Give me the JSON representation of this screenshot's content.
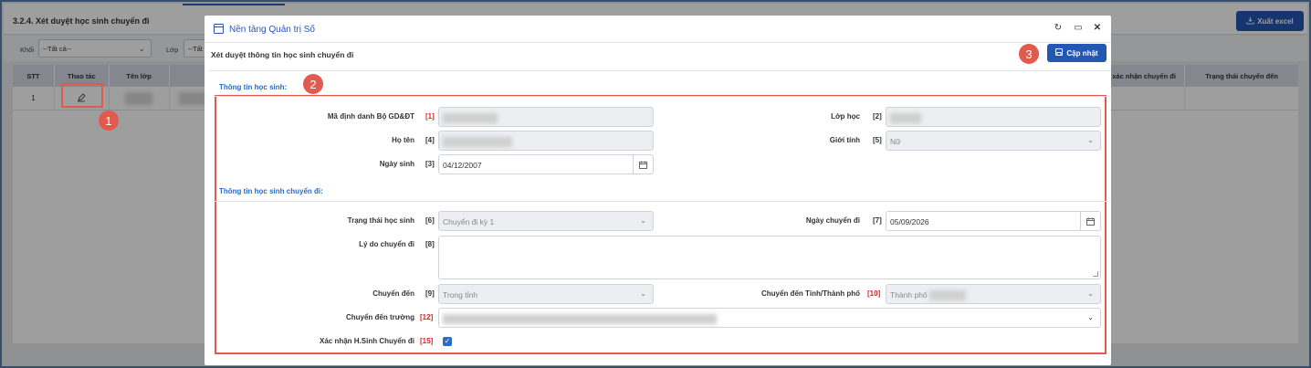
{
  "page": {
    "title": "3.2.4. Xét duyệt học sinh chuyển đi",
    "export_label": "Xuất excel",
    "filters": {
      "khoi_label": "Khối",
      "khoi_value": "--Tất cả--",
      "lop_label": "Lớp",
      "lop_value": "--Tất c"
    },
    "grid": {
      "columns": [
        "STT",
        "Thao tác",
        "Tên lớp",
        "",
        "",
        "...",
        "à xác nhận chuyển đi",
        "Trạng thái chuyển đến"
      ],
      "rows": [
        {
          "stt": "1"
        }
      ]
    }
  },
  "modal": {
    "title": "Nền tảng Quản trị Số",
    "subtitle": "Xét duyệt thông tin học sinh chuyển đi",
    "update_label": "Cập nhật",
    "section_student": "Thông tin học sinh:",
    "section_transfer": "Thông tin học sinh chuyển đi:",
    "fields": {
      "ma_dinh_danh": {
        "label": "Mã định danh Bộ GD&ĐT",
        "index": "[1]"
      },
      "lop_hoc": {
        "label": "Lớp học",
        "index": "[2]"
      },
      "ho_ten": {
        "label": "Họ tên",
        "index": "[4]"
      },
      "gioi_tinh": {
        "label": "Giới tính",
        "index": "[5]",
        "value": "Nữ"
      },
      "ngay_sinh": {
        "label": "Ngày sinh",
        "index": "[3]",
        "value": "04/12/2007"
      },
      "trang_thai": {
        "label": "Trạng thái học sinh",
        "index": "[6]",
        "value": "Chuyển đi kỳ 1"
      },
      "ngay_chuyen_di": {
        "label": "Ngày chuyển đi",
        "index": "[7]",
        "value": "05/09/2026"
      },
      "ly_do": {
        "label": "Lý do chuyển đi",
        "index": "[8]",
        "value": ""
      },
      "chuyen_den": {
        "label": "Chuyển đến",
        "index": "[9]",
        "value": "Trong tỉnh"
      },
      "chuyen_den_tinh": {
        "label": "Chuyển đến Tỉnh/Thành phố",
        "index": "[10]",
        "value": "Thành phố"
      },
      "chuyen_den_truong": {
        "label": "Chuyển đến trường",
        "index": "[12]"
      },
      "xac_nhan": {
        "label": "Xác nhận H.Sinh Chuyển đi",
        "index": "[15]",
        "checked": true
      }
    }
  },
  "annotations": {
    "one": "1",
    "two": "2",
    "three": "3"
  },
  "colors": {
    "brand": "#2456b4",
    "accent_red": "#e05a4e",
    "section_blue": "#2b6cc4"
  }
}
